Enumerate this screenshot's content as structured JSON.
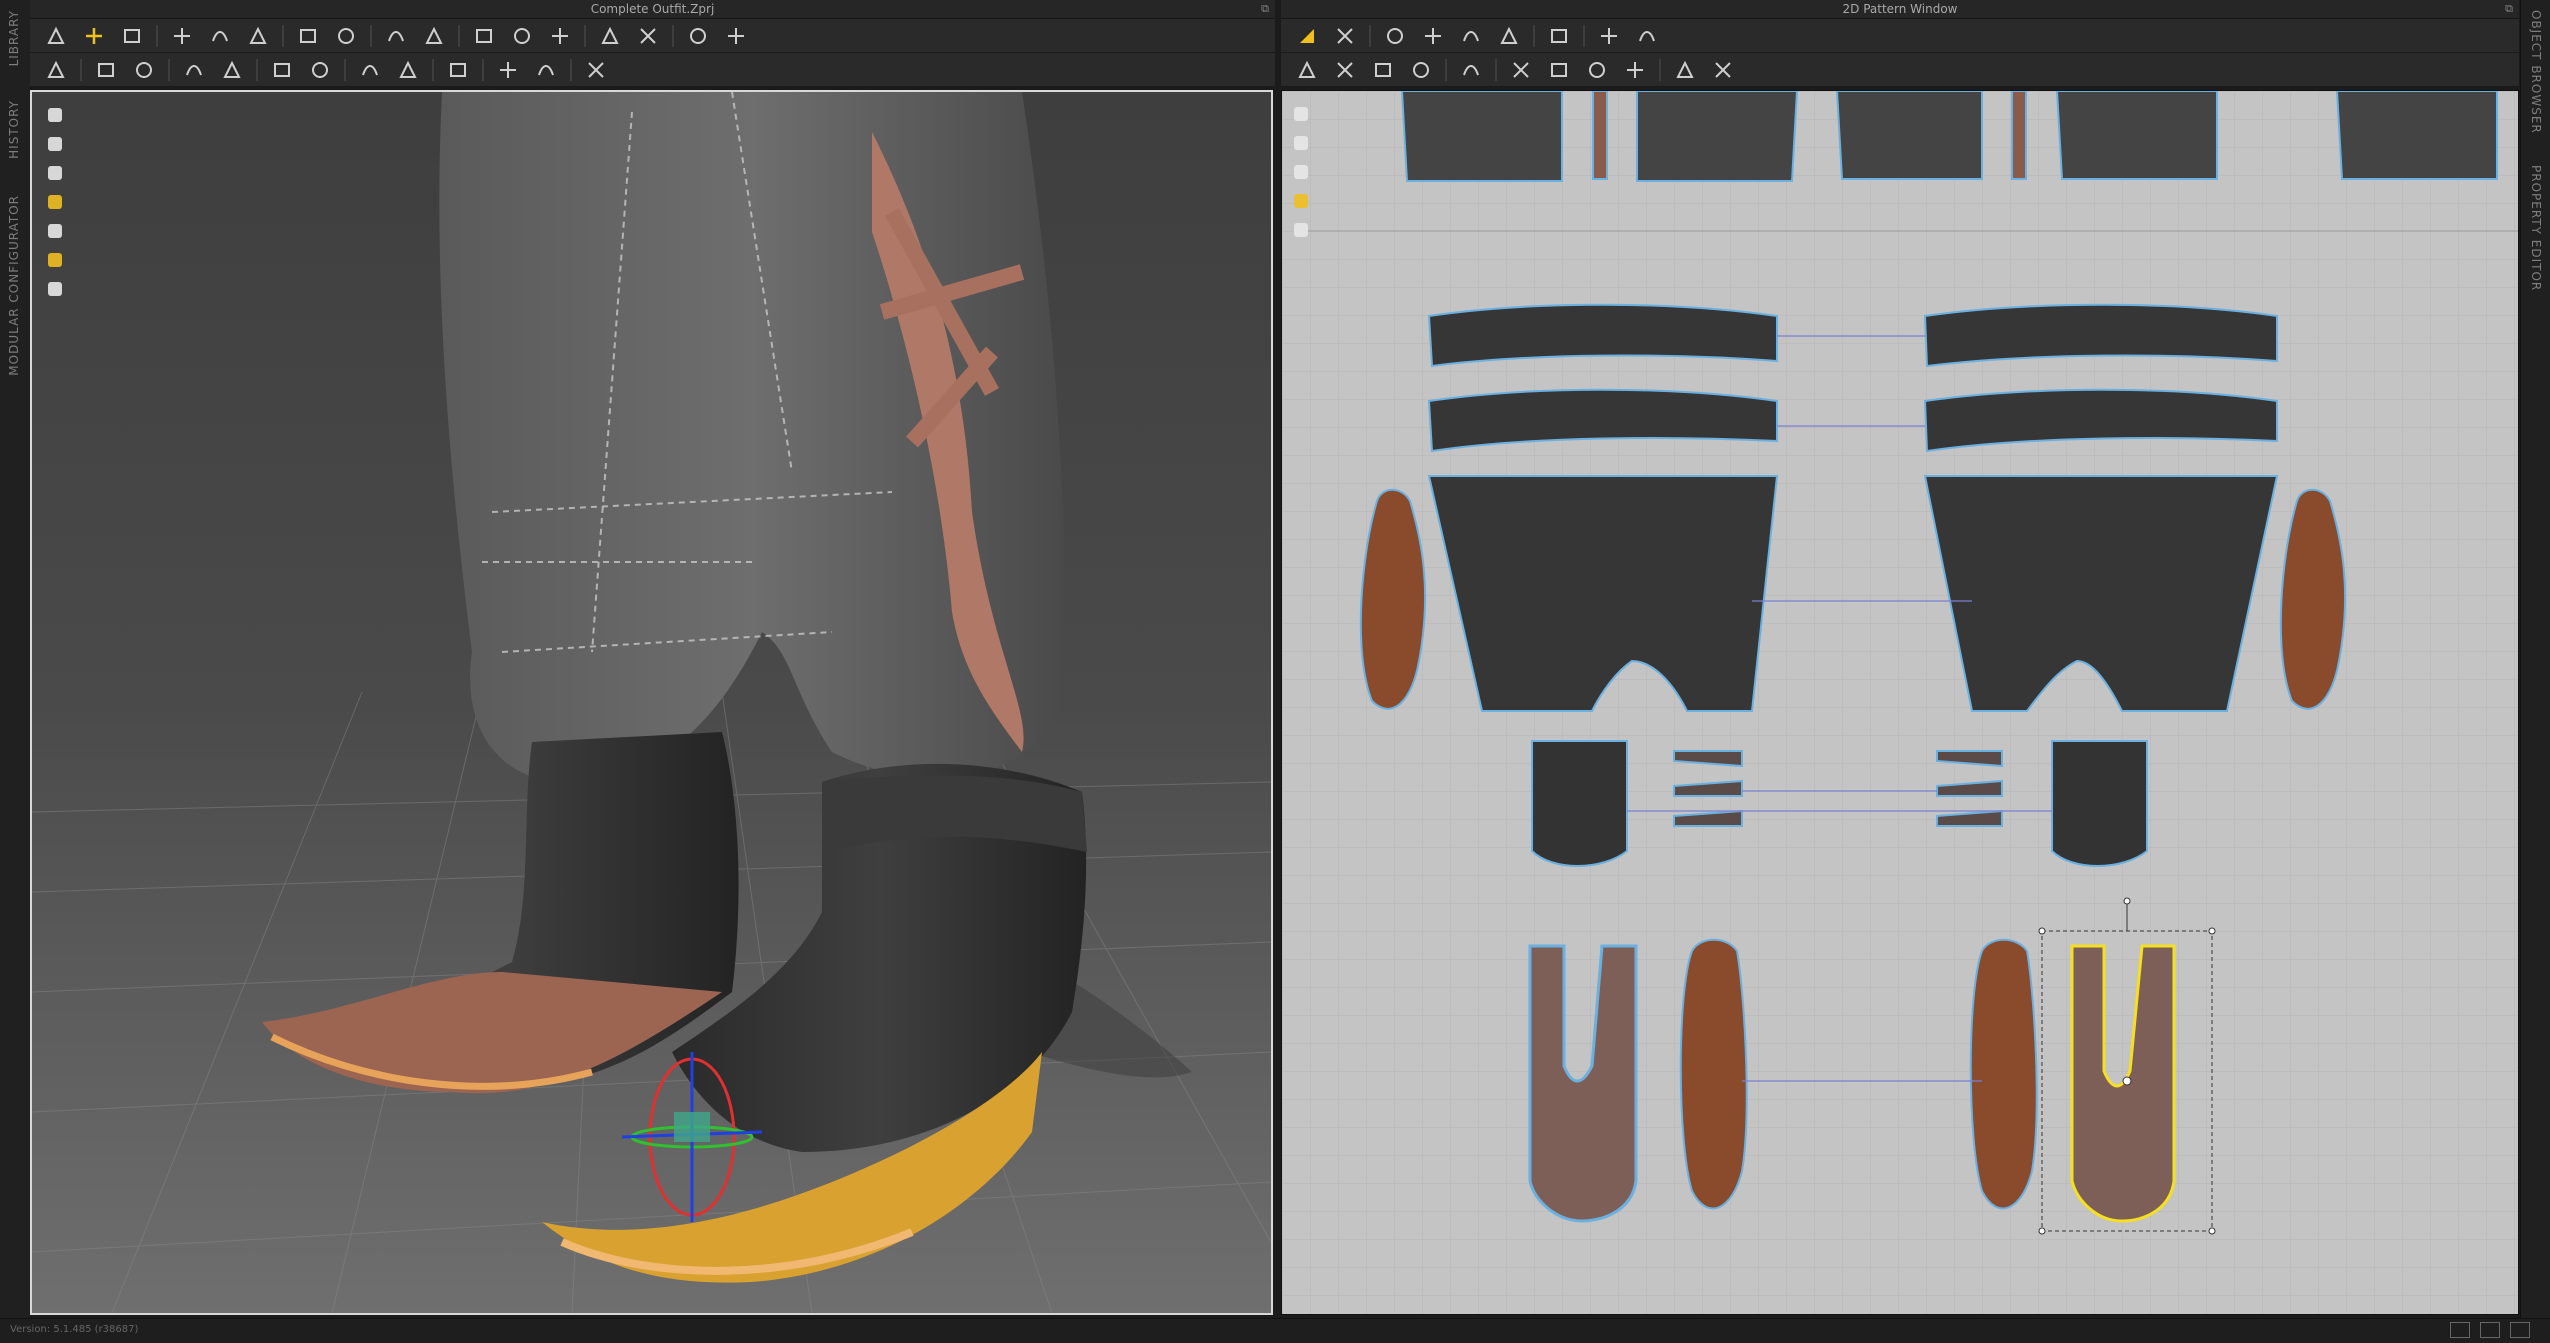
{
  "side_left": {
    "tabs": [
      "LIBRARY",
      "HISTORY",
      "MODULAR CONFIGURATOR"
    ]
  },
  "side_right": {
    "tabs": [
      "OBJECT BROWSER",
      "PROPERTY EDITOR"
    ]
  },
  "window_3d": {
    "title": "Complete Outfit.Zprj",
    "toolbar_row1": [
      "simulate-icon",
      "move-icon",
      "select-mesh-icon",
      "sep",
      "edit-pattern-icon",
      "edit-curve-icon",
      "edit-point-icon",
      "sep",
      "segment-line-icon",
      "fold-icon",
      "sep",
      "sewing-icon",
      "multi-sewing-icon",
      "sep",
      "pin-icon",
      "avatar-measure-icon",
      "garment-icon",
      "sep",
      "tuck-icon",
      "puckering-icon",
      "sep",
      "grid-icon",
      "mesh-grid-icon"
    ],
    "toolbar_row2": [
      "avatar-pose-icon",
      "sep",
      "select-pin-icon",
      "transform-pin-icon",
      "sep",
      "measure-icon",
      "cut-icon",
      "sep",
      "strengthen-icon",
      "wrinkle-icon",
      "sep",
      "button-icon",
      "buttonhole-icon",
      "sep",
      "trim-icon",
      "sep",
      "zipper-icon",
      "piping-icon",
      "sep",
      "gizmo-icon"
    ],
    "viewport_tools": [
      "garment-view-icon",
      "texture-view-icon",
      "avatar-view-icon",
      "pattern-view-icon",
      "flat-view-icon",
      "avatar-face-icon",
      "sphere-view-icon"
    ]
  },
  "window_2d": {
    "title": "2D Pattern Window",
    "toolbar_row1": [
      "transform-pattern-icon",
      "edit-segment-icon",
      "sep",
      "polygon-icon",
      "rectangle-icon",
      "circle-icon",
      "internal-icon",
      "sep",
      "sewing-line-icon",
      "sep",
      "grid-2d-icon",
      "mesh-2d-icon"
    ],
    "toolbar_row2": [
      "edit-pattern-2d-icon",
      "edit-curve-2d-icon",
      "edit-point-2d-icon",
      "curve-point-icon",
      "sep",
      "fold-arrange-icon",
      "sep",
      "segment-sewing-icon",
      "free-sewing-icon",
      "mesh-sewing-icon",
      "dart-icon",
      "sep",
      "ruler-icon",
      "measure-line-icon"
    ],
    "viewport_tools": [
      "pen-tool-icon",
      "select-tool-icon",
      "info-tool-icon",
      "color-tool-icon",
      "hide-tool-icon"
    ]
  },
  "colors": {
    "accent": "#f0c020",
    "pattern_fill": "#3a3a3a",
    "leather_fill": "#8a4a30",
    "outline_blue": "#8cc8e8",
    "selected_yellow": "#f5e020"
  },
  "status": {
    "version": "Version: 5.1.485 (r38687)"
  }
}
